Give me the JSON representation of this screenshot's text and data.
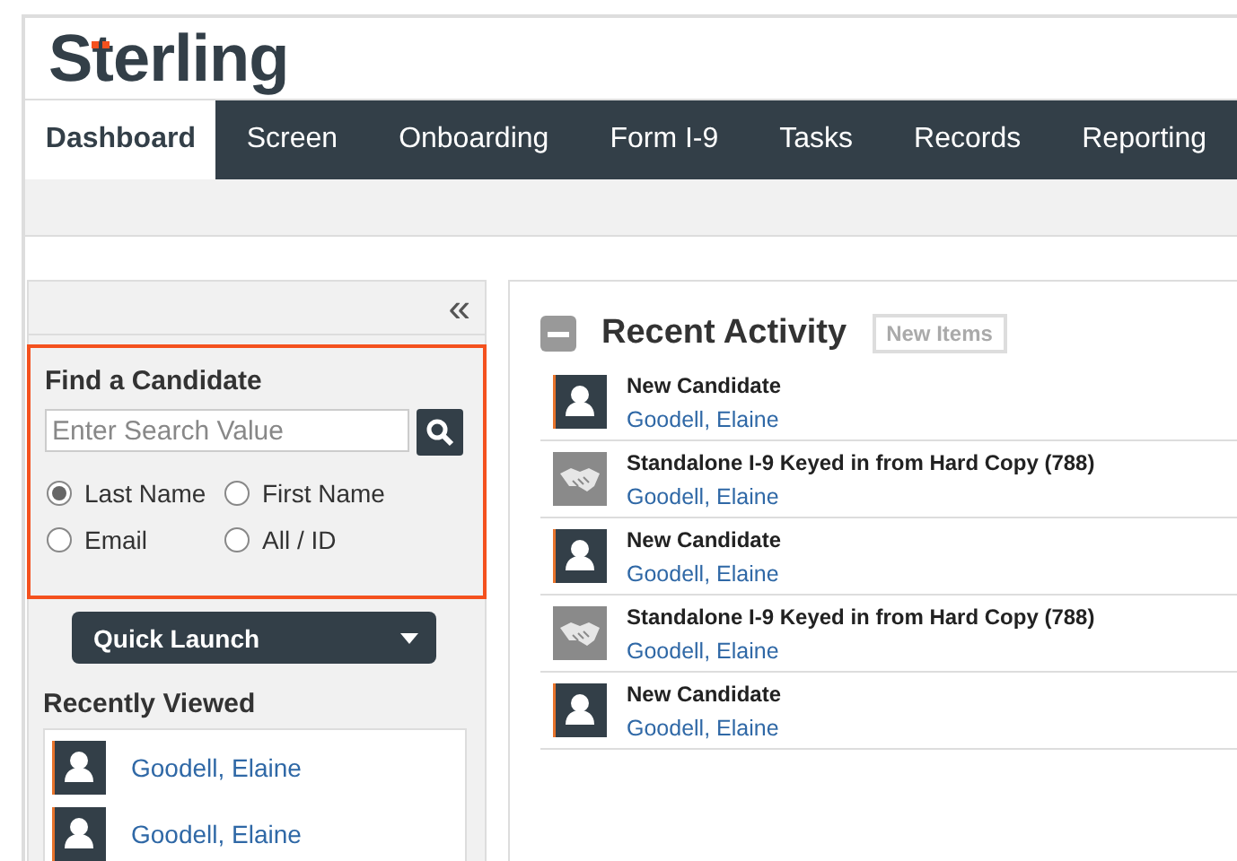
{
  "logo": "Sterling",
  "tabs": [
    {
      "label": "Dashboard",
      "selected": true
    },
    {
      "label": "Screen",
      "selected": false
    },
    {
      "label": "Onboarding",
      "selected": false
    },
    {
      "label": "Form I-9",
      "selected": false
    },
    {
      "label": "Tasks",
      "selected": false
    },
    {
      "label": "Records",
      "selected": false
    },
    {
      "label": "Reporting",
      "selected": false
    }
  ],
  "sidebar": {
    "collapse": "«",
    "find": {
      "title": "Find a Candidate",
      "placeholder": "Enter Search Value",
      "options": [
        {
          "label": "Last Name",
          "selected": true
        },
        {
          "label": "First Name",
          "selected": false
        },
        {
          "label": "Email",
          "selected": false
        },
        {
          "label": "All / ID",
          "selected": false
        }
      ]
    },
    "quick_launch": "Quick Launch",
    "recently_viewed": {
      "title": "Recently Viewed",
      "items": [
        "Goodell, Elaine",
        "Goodell, Elaine"
      ]
    }
  },
  "activity": {
    "title": "Recent Activity",
    "new_items": "New Items",
    "items": [
      {
        "kind": "candidate",
        "title": "New Candidate",
        "name": "Goodell, Elaine"
      },
      {
        "kind": "form",
        "title": "Standalone I-9 Keyed in from Hard Copy (788)",
        "name": "Goodell, Elaine"
      },
      {
        "kind": "candidate",
        "title": "New Candidate",
        "name": "Goodell, Elaine"
      },
      {
        "kind": "form",
        "title": "Standalone I-9 Keyed in from Hard Copy (788)",
        "name": "Goodell, Elaine"
      },
      {
        "kind": "candidate",
        "title": "New Candidate",
        "name": "Goodell, Elaine"
      }
    ]
  }
}
